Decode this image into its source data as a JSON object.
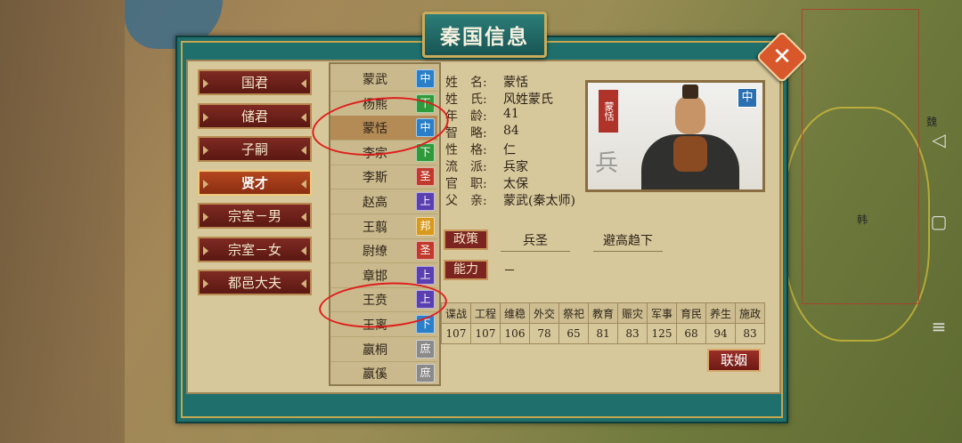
{
  "window": {
    "title": "秦国信息"
  },
  "map_labels": [
    "魏",
    "韩"
  ],
  "categories": [
    {
      "label": "国君",
      "active": false
    },
    {
      "label": "储君",
      "active": false
    },
    {
      "label": "子嗣",
      "active": false
    },
    {
      "label": "贤才",
      "active": true
    },
    {
      "label": "宗室－男",
      "active": false
    },
    {
      "label": "宗室－女",
      "active": false
    },
    {
      "label": "都邑大夫",
      "active": false
    }
  ],
  "persons": [
    {
      "name": "蒙武",
      "rank": "中",
      "color": "#2a7fc8"
    },
    {
      "name": "杨熊",
      "rank": "下",
      "color": "#2f9a3a"
    },
    {
      "name": "蒙恬",
      "rank": "中",
      "color": "#2a7fc8",
      "selected": true
    },
    {
      "name": "李宗",
      "rank": "下",
      "color": "#2f9a3a"
    },
    {
      "name": "李斯",
      "rank": "圣",
      "color": "#c0392b"
    },
    {
      "name": "赵高",
      "rank": "上",
      "color": "#5a3fb0"
    },
    {
      "name": "王翦",
      "rank": "邦",
      "color": "#d89a1c"
    },
    {
      "name": "尉缭",
      "rank": "圣",
      "color": "#c0392b"
    },
    {
      "name": "章邯",
      "rank": "上",
      "color": "#5a3fb0"
    },
    {
      "name": "王贲",
      "rank": "上",
      "color": "#5a3fb0"
    },
    {
      "name": "王离",
      "rank": "下",
      "color": "#2a7fc8"
    },
    {
      "name": "嬴桐",
      "rank": "庶",
      "color": "#8a8a8a"
    },
    {
      "name": "嬴傒",
      "rank": "庶",
      "color": "#8a8a8a"
    }
  ],
  "info": {
    "name_label": "姓　名:",
    "name": "蒙恬",
    "clan_label": "姓　氏:",
    "clan": "风姓蒙氏",
    "age_label": "年　龄:",
    "age": "41",
    "intel_label": "智　略:",
    "intel": "84",
    "trait_label": "性　格:",
    "trait": "仁",
    "school_label": "流　派:",
    "school": "兵家",
    "office_label": "官　职:",
    "office": "太保",
    "father_label": "父　亲:",
    "father": "蒙武(秦太师)"
  },
  "portrait": {
    "stamp": "蒙恬",
    "ink": "兵",
    "badge": "中"
  },
  "policy": {
    "label": "政策",
    "value1": "兵圣",
    "value2": "避高趋下"
  },
  "ability": {
    "label": "能力",
    "value": "－"
  },
  "stats": {
    "headers": [
      "谍战",
      "工程",
      "维稳",
      "外交",
      "祭祀",
      "教育",
      "赈灾",
      "军事",
      "育民",
      "养生",
      "施政"
    ],
    "values": [
      "107",
      "107",
      "106",
      "78",
      "65",
      "81",
      "83",
      "125",
      "68",
      "94",
      "83"
    ]
  },
  "marry_button": "联姻"
}
